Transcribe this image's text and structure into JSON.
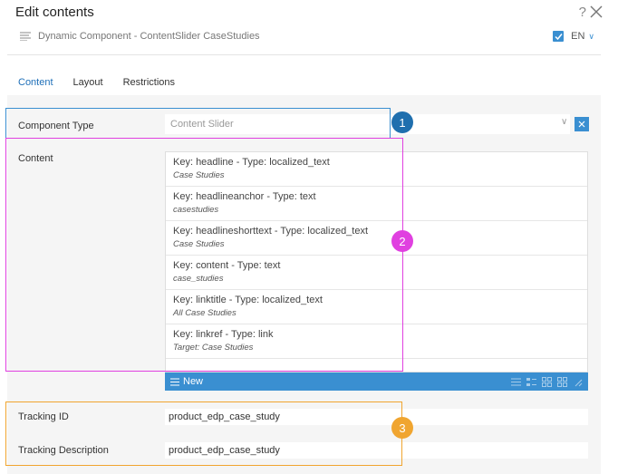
{
  "header": {
    "title": "Edit contents",
    "help": "?",
    "subtitle": "Dynamic Component - ContentSlider CaseStudies",
    "language": "EN"
  },
  "tabs": [
    {
      "label": "Content",
      "active": true
    },
    {
      "label": "Layout",
      "active": false
    },
    {
      "label": "Restrictions",
      "active": false
    }
  ],
  "component_type": {
    "label": "Component Type",
    "value": "Content Slider"
  },
  "content": {
    "label": "Content",
    "items": [
      {
        "key": "Key: headline - Type: localized_text",
        "value": "Case Studies"
      },
      {
        "key": "Key: headlineanchor - Type: text",
        "value": "casestudies"
      },
      {
        "key": "Key: headlineshorttext - Type: localized_text",
        "value": "Case Studies"
      },
      {
        "key": "Key: content - Type: text",
        "value": "case_studies"
      },
      {
        "key": "Key: linktitle - Type: localized_text",
        "value": "All Case Studies"
      },
      {
        "key": "Key: linkref - Type: link",
        "value": "Target: Case Studies"
      }
    ],
    "new_label": "New"
  },
  "tracking_id": {
    "label": "Tracking ID",
    "value": "product_edp_case_study"
  },
  "tracking_description": {
    "label": "Tracking Description",
    "value": "product_edp_case_study"
  },
  "annotations": [
    "1",
    "2",
    "3"
  ],
  "colors": {
    "accent": "#3a8fd1",
    "magenta": "#e040e0",
    "orange": "#f0a530",
    "badge_blue": "#1f6fae"
  }
}
